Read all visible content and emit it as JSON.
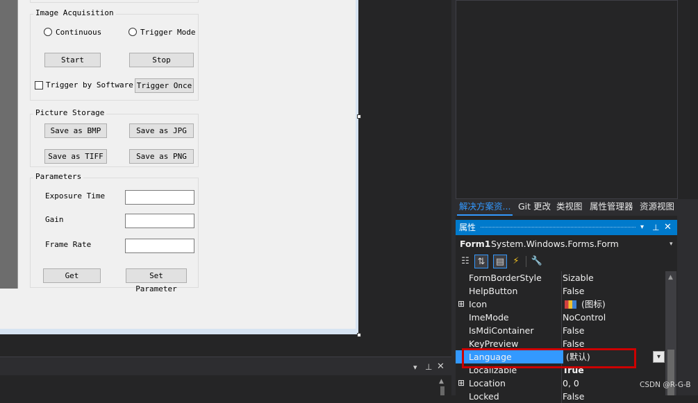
{
  "form": {
    "acquisition": {
      "title": "Image Acquisition",
      "radio_continuous": "Continuous",
      "radio_trigger": "Trigger Mode",
      "start": "Start",
      "stop": "Stop",
      "trigger_software": "Trigger by Software",
      "trigger_once": "Trigger Once"
    },
    "storage": {
      "title": "Picture Storage",
      "bmp": "Save as BMP",
      "jpg": "Save as JPG",
      "tiff": "Save as TIFF",
      "png": "Save as PNG"
    },
    "parameters": {
      "title": "Parameters",
      "exposure": "Exposure Time",
      "gain": "Gain",
      "frame_rate": "Frame Rate",
      "get": "Get",
      "set": "Set Parameter"
    }
  },
  "tabs": [
    "解决方案资...",
    "Git 更改",
    "类视图",
    "属性管理器",
    "资源视图"
  ],
  "properties": {
    "title": "属性",
    "object_name": "Form1",
    "object_type": "System.Windows.Forms.Form",
    "rows": [
      {
        "name": "FormBorderStyle",
        "value": "Sizable"
      },
      {
        "name": "HelpButton",
        "value": "False"
      },
      {
        "name": "Icon",
        "value": "(图标)"
      },
      {
        "name": "ImeMode",
        "value": "NoControl"
      },
      {
        "name": "IsMdiContainer",
        "value": "False"
      },
      {
        "name": "KeyPreview",
        "value": "False"
      },
      {
        "name": "Language",
        "value": "(默认)"
      },
      {
        "name": "Localizable",
        "value": "True"
      },
      {
        "name": "Location",
        "value": "0, 0"
      },
      {
        "name": "Locked",
        "value": "False"
      }
    ]
  },
  "watermark": "CSDN @R-G-B",
  "colors": {
    "accent": "#007acc",
    "highlight": "#cc0000",
    "selected": "#3399ff"
  }
}
